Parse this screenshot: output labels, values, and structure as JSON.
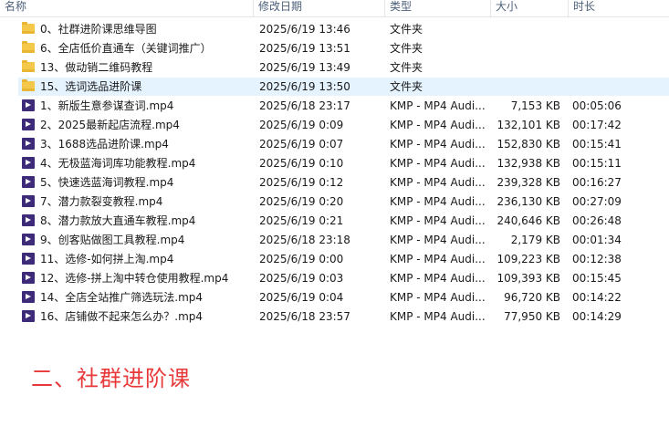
{
  "columns": {
    "name": "名称",
    "date": "修改日期",
    "type": "类型",
    "size": "大小",
    "duration": "时长"
  },
  "rows": [
    {
      "name": "0、社群进阶课思维导图",
      "date": "2025/6/19 13:46",
      "type": "文件夹",
      "size": "",
      "duration": "",
      "icon": "folder-icon"
    },
    {
      "name": "6、全店低价直通车（关键词推广）",
      "date": "2025/6/19 13:51",
      "type": "文件夹",
      "size": "",
      "duration": "",
      "icon": "folder-icon"
    },
    {
      "name": "13、做动销二维码教程",
      "date": "2025/6/19 13:49",
      "type": "文件夹",
      "size": "",
      "duration": "",
      "icon": "folder-icon"
    },
    {
      "name": "15、选词选品进阶课",
      "date": "2025/6/19 13:50",
      "type": "文件夹",
      "size": "",
      "duration": "",
      "icon": "folder-icon",
      "selected": true
    },
    {
      "name": "1、新版生意参谋查词.mp4",
      "date": "2025/6/18 23:17",
      "type": "KMP - MP4 Audi...",
      "size": "7,153 KB",
      "duration": "00:05:06",
      "icon": "video-file-icon"
    },
    {
      "name": "2、2025最新起店流程.mp4",
      "date": "2025/6/19 0:09",
      "type": "KMP - MP4 Audi...",
      "size": "132,101 KB",
      "duration": "00:17:42",
      "icon": "video-file-icon"
    },
    {
      "name": "3、1688选品进阶课.mp4",
      "date": "2025/6/19 0:07",
      "type": "KMP - MP4 Audi...",
      "size": "152,830 KB",
      "duration": "00:15:41",
      "icon": "video-file-icon"
    },
    {
      "name": "4、无极蓝海词库功能教程.mp4",
      "date": "2025/6/19 0:10",
      "type": "KMP - MP4 Audi...",
      "size": "132,938 KB",
      "duration": "00:15:11",
      "icon": "video-file-icon"
    },
    {
      "name": "5、快速选蓝海词教程.mp4",
      "date": "2025/6/19 0:12",
      "type": "KMP - MP4 Audi...",
      "size": "239,328 KB",
      "duration": "00:16:27",
      "icon": "video-file-icon"
    },
    {
      "name": "7、潜力款裂变教程.mp4",
      "date": "2025/6/19 0:20",
      "type": "KMP - MP4 Audi...",
      "size": "236,130 KB",
      "duration": "00:27:09",
      "icon": "video-file-icon"
    },
    {
      "name": "8、潜力款放大直通车教程.mp4",
      "date": "2025/6/19 0:21",
      "type": "KMP - MP4 Audi...",
      "size": "240,646 KB",
      "duration": "00:26:48",
      "icon": "video-file-icon"
    },
    {
      "name": "9、创客贴做图工具教程.mp4",
      "date": "2025/6/18 23:18",
      "type": "KMP - MP4 Audi...",
      "size": "2,179 KB",
      "duration": "00:01:34",
      "icon": "video-file-icon"
    },
    {
      "name": "11、选修-如何拼上淘.mp4",
      "date": "2025/6/19 0:00",
      "type": "KMP - MP4 Audi...",
      "size": "109,223 KB",
      "duration": "00:12:38",
      "icon": "video-file-icon"
    },
    {
      "name": "12、选修-拼上淘中转仓使用教程.mp4",
      "date": "2025/6/19 0:03",
      "type": "KMP - MP4 Audi...",
      "size": "109,393 KB",
      "duration": "00:15:45",
      "icon": "video-file-icon"
    },
    {
      "name": "14、全店全站推广筛选玩法.mp4",
      "date": "2025/6/19 0:04",
      "type": "KMP - MP4 Audi...",
      "size": "96,720 KB",
      "duration": "00:14:22",
      "icon": "video-file-icon"
    },
    {
      "name": "16、店铺做不起来怎么办？.mp4",
      "date": "2025/6/18 23:57",
      "type": "KMP - MP4 Audi...",
      "size": "77,950 KB",
      "duration": "00:14:29",
      "icon": "video-file-icon"
    }
  ],
  "annotation": "二、社群进阶课",
  "colors": {
    "selected_row": "#e5f3ff",
    "folder": "#f3c84b",
    "video_icon": "#3d2a78",
    "annotation": "#e8393a",
    "header_text": "#4c607a"
  }
}
